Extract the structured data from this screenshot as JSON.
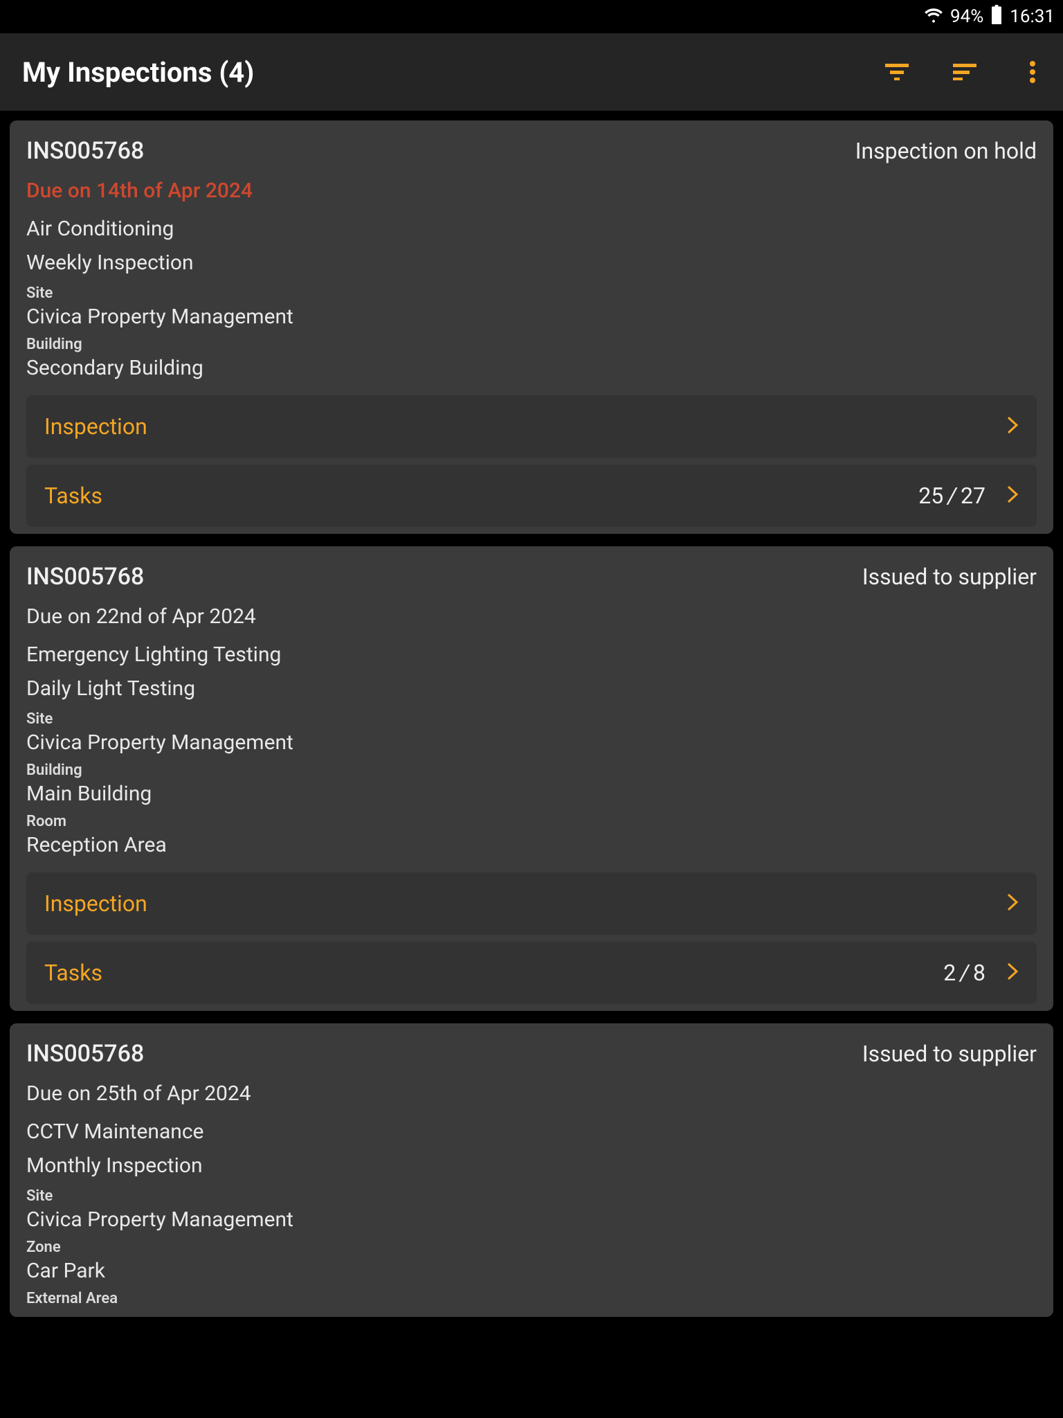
{
  "status_bar": {
    "battery": "94%",
    "time": "16:31"
  },
  "header": {
    "title": "My Inspections (4)"
  },
  "labels": {
    "inspection": "Inspection",
    "tasks": "Tasks",
    "site": "Site",
    "building": "Building",
    "room": "Room",
    "zone": "Zone",
    "external_area": "External Area"
  },
  "cards": [
    {
      "id": "INS005768",
      "status": "Inspection on hold",
      "due": "Due on 14th of Apr 2024",
      "overdue": true,
      "line1": "Air Conditioning",
      "line2": "Weekly Inspection",
      "site": "Civica Property Management",
      "building": "Secondary Building",
      "tasks_done": "25",
      "tasks_total": "27"
    },
    {
      "id": "INS005768",
      "status": "Issued to supplier",
      "due": "Due on 22nd of Apr 2024",
      "overdue": false,
      "line1": "Emergency Lighting Testing",
      "line2": "Daily Light Testing",
      "site": "Civica Property Management",
      "building": "Main Building",
      "room": "Reception Area",
      "tasks_done": "2",
      "tasks_total": "8"
    },
    {
      "id": "INS005768",
      "status": "Issued to supplier",
      "due": "Due on 25th of Apr 2024",
      "overdue": false,
      "line1": "CCTV Maintenance",
      "line2": "Monthly Inspection",
      "site": "Civica Property Management",
      "zone": "Car Park",
      "external_area": ""
    }
  ]
}
